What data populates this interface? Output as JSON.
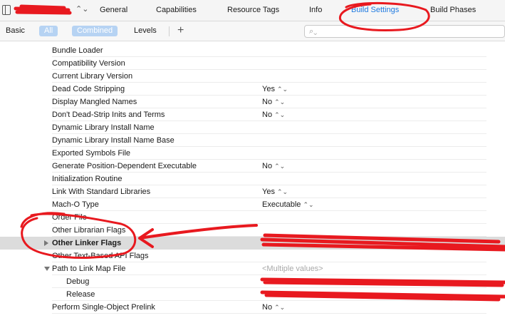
{
  "tabs": {
    "items": [
      {
        "label": "General",
        "active": false
      },
      {
        "label": "Capabilities",
        "active": false
      },
      {
        "label": "Resource Tags",
        "active": false
      },
      {
        "label": "Info",
        "active": false
      },
      {
        "label": "Build Settings",
        "active": true
      },
      {
        "label": "Build Phases",
        "active": false
      }
    ]
  },
  "filter": {
    "basic": "Basic",
    "all": "All",
    "combined": "Combined",
    "levels": "Levels",
    "add": "+",
    "search_placeholder": ""
  },
  "settings": [
    {
      "name": "Bundle Loader",
      "value": ""
    },
    {
      "name": "Compatibility Version",
      "value": ""
    },
    {
      "name": "Current Library Version",
      "value": ""
    },
    {
      "name": "Dead Code Stripping",
      "value": "Yes"
    },
    {
      "name": "Display Mangled Names",
      "value": "No"
    },
    {
      "name": "Don't Dead-Strip Inits and Terms",
      "value": "No"
    },
    {
      "name": "Dynamic Library Install Name",
      "value": ""
    },
    {
      "name": "Dynamic Library Install Name Base",
      "value": ""
    },
    {
      "name": "Exported Symbols File",
      "value": ""
    },
    {
      "name": "Generate Position-Dependent Executable",
      "value": "No"
    },
    {
      "name": "Initialization Routine",
      "value": ""
    },
    {
      "name": "Link With Standard Libraries",
      "value": "Yes"
    },
    {
      "name": "Mach-O Type",
      "value": "Executable"
    },
    {
      "name": "Order File",
      "value": ""
    },
    {
      "name": "Other Librarian Flags",
      "value": ""
    },
    {
      "name": "Other Linker Flags",
      "value": ""
    },
    {
      "name": "Other Text-Based API Flags",
      "value": ""
    },
    {
      "name": "Path to Link Map File",
      "value": "<Multiple values>"
    },
    {
      "name": "Debug",
      "value": ""
    },
    {
      "name": "Release",
      "value": ""
    },
    {
      "name": "Perform Single-Object Prelink",
      "value": "No"
    }
  ],
  "colors": {
    "accent": "#1f7ae0",
    "annotation": "#e8191f",
    "selected_row": "#dcdcdc"
  }
}
